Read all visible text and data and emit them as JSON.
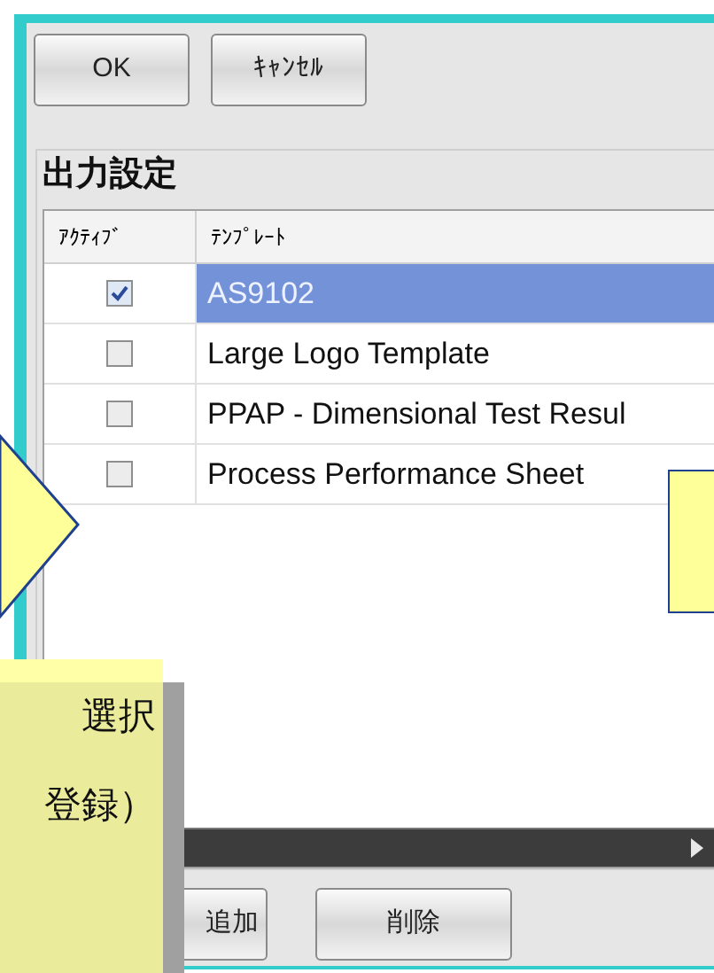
{
  "top_buttons": [
    {
      "label": "OK"
    },
    {
      "label": "ｷｬﾝｾﾙ"
    }
  ],
  "output_settings": {
    "title": "出力設定",
    "columns": [
      "ｱｸﾃｨﾌﾞ",
      "ﾃﾝﾌﾟﾚｰﾄ"
    ],
    "rows": [
      {
        "active": true,
        "template": "AS9102",
        "selected": true
      },
      {
        "active": false,
        "template": "Large Logo Template",
        "selected": false
      },
      {
        "active": false,
        "template": "PPAP - Dimensional Test Resul",
        "selected": false
      },
      {
        "active": false,
        "template": "Process Performance Sheet",
        "selected": false
      }
    ]
  },
  "bottom_buttons": [
    {
      "label": "追加"
    },
    {
      "label": "削除"
    }
  ],
  "note": {
    "lines": [
      "選択",
      "登録）"
    ]
  }
}
